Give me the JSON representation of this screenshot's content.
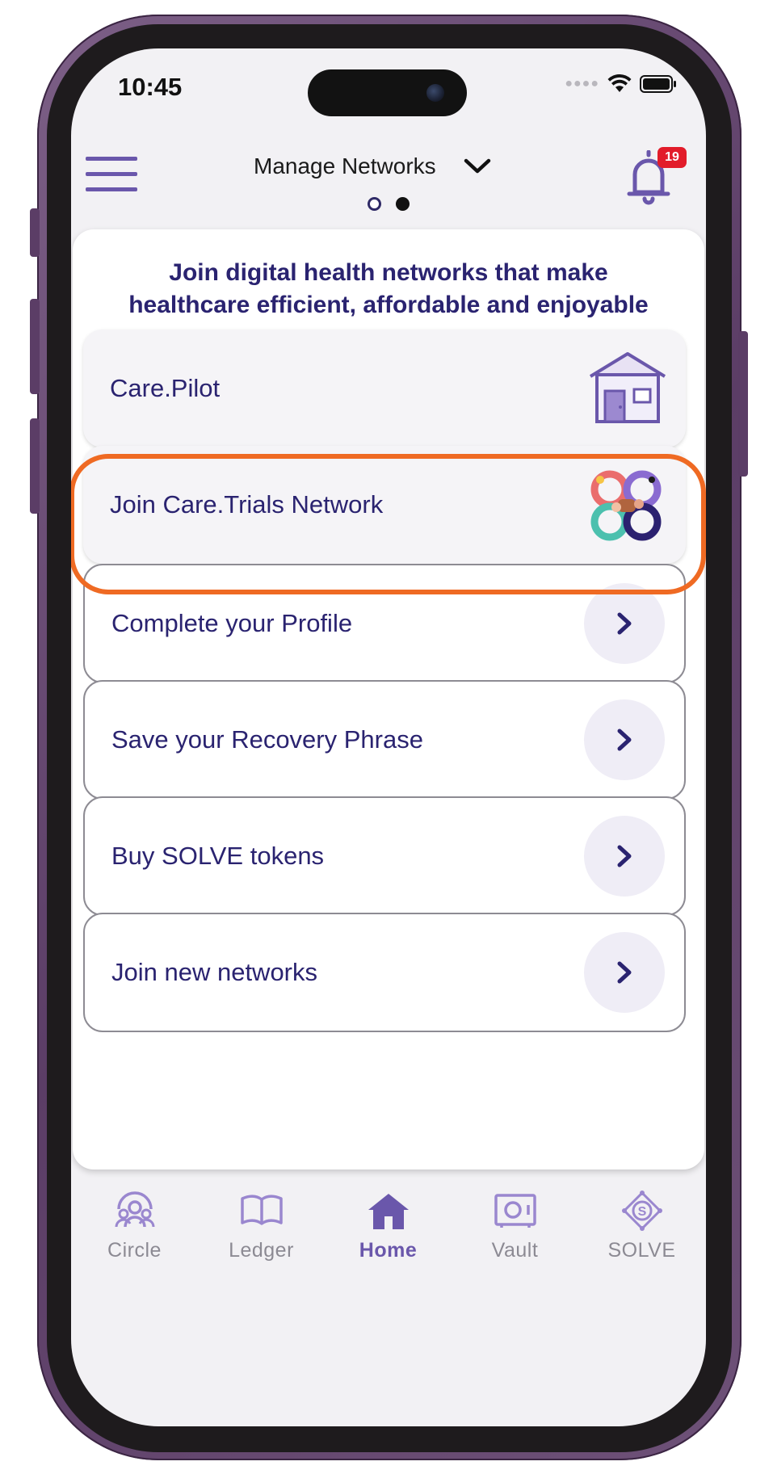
{
  "status_bar": {
    "time": "10:45"
  },
  "header": {
    "title": "Manage Networks",
    "notification_count": "19",
    "icons": {
      "menu": "hamburger-menu-icon",
      "dropdown": "chevron-down-icon",
      "notifications": "bell-icon"
    }
  },
  "pager": {
    "pages": 2,
    "active_index": 1
  },
  "card": {
    "heading_line1": "Join digital health networks that make",
    "heading_line2": "healthcare efficient, affordable and enjoyable"
  },
  "featured_tiles": [
    {
      "label": "Care.Pilot",
      "icon": "house-icon"
    },
    {
      "label": "Join Care.Trials Network",
      "icon": "care-trials-logo"
    }
  ],
  "task_tiles": [
    {
      "label": "Complete your Profile",
      "icon": "chevron-right-icon"
    },
    {
      "label": "Save your Recovery Phrase",
      "icon": "chevron-right-icon"
    },
    {
      "label": "Buy SOLVE tokens",
      "icon": "chevron-right-icon"
    },
    {
      "label": "Join new networks",
      "icon": "chevron-right-icon"
    }
  ],
  "tabbar": {
    "tabs": [
      {
        "label": "Circle",
        "icon": "circle-people-icon",
        "active": false
      },
      {
        "label": "Ledger",
        "icon": "book-icon",
        "active": false
      },
      {
        "label": "Home",
        "icon": "home-icon",
        "active": true
      },
      {
        "label": "Vault",
        "icon": "vault-icon",
        "active": false
      },
      {
        "label": "SOLVE",
        "icon": "solve-token-icon",
        "active": false
      }
    ]
  },
  "colors": {
    "accent_purple": "#6a57ab",
    "heading_navy": "#2a2370",
    "highlight_orange": "#ef6a23",
    "badge_red": "#e21c2a",
    "frame_purple": "#5b3d66"
  }
}
